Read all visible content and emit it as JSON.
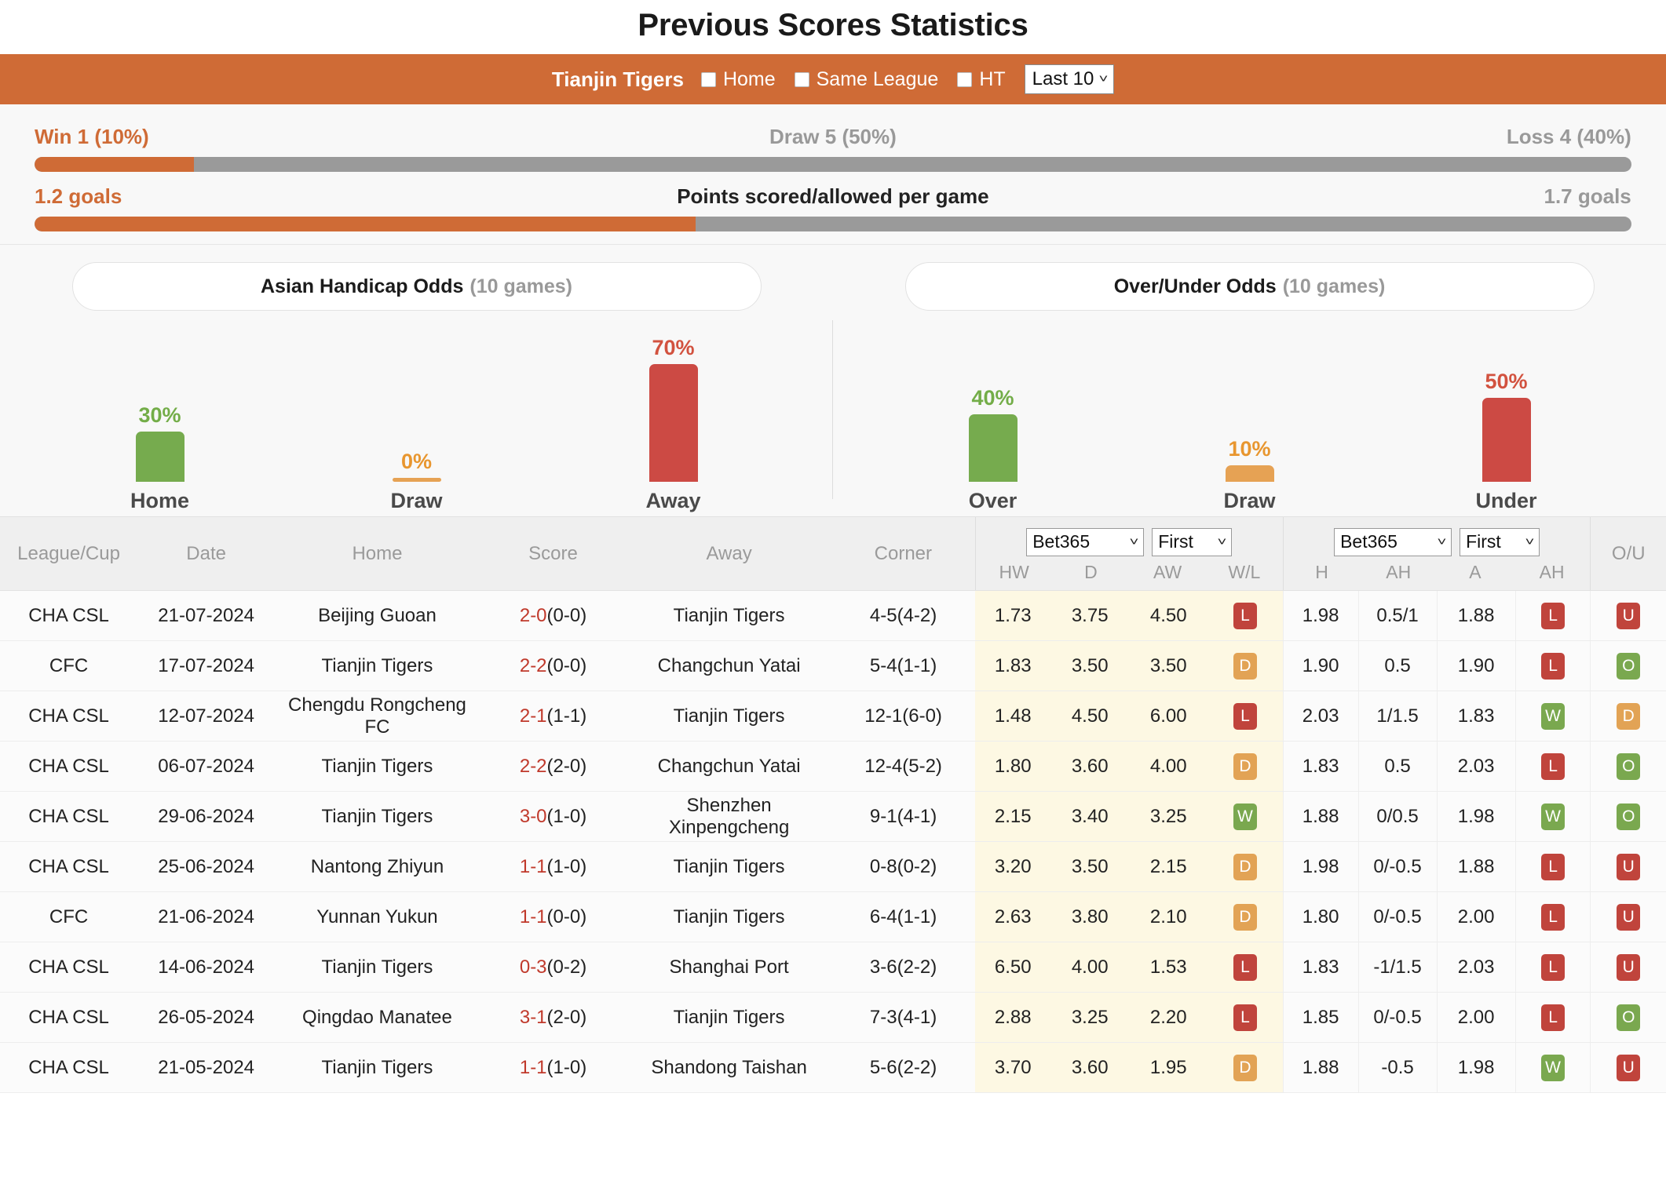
{
  "page_title": "Previous Scores Statistics",
  "filter_bar": {
    "team": "Tianjin Tigers",
    "checkbox_home": "Home",
    "checkbox_same_league": "Same League",
    "checkbox_ht": "HT",
    "range_select": "Last 10",
    "caret_icon": "chevron-down-icon"
  },
  "summary": {
    "win_label": "Win 1 (10%)",
    "draw_label": "Draw 5 (50%)",
    "loss_label": "Loss 4 (40%)",
    "win_pct": 10,
    "goals_scored": "1.2 goals",
    "goals_title": "Points scored/allowed per game",
    "goals_allowed": "1.7 goals",
    "goals_fill_pct": 41.4,
    "accent_color": "#cf6b36",
    "muted_color": "#9a9a9a"
  },
  "odds_panels": [
    {
      "title": "Asian Handicap Odds",
      "games": "(10 games)",
      "bars": [
        {
          "label": "Home",
          "pct": "30%",
          "value": 30,
          "color": "#76ab4e",
          "text_class": "c-green",
          "bg_class": "bg-green"
        },
        {
          "label": "Draw",
          "pct": "0%",
          "value": 0,
          "color": "#e6a254",
          "text_class": "c-orange",
          "bg_class": "bg-orange"
        },
        {
          "label": "Away",
          "pct": "70%",
          "value": 70,
          "color": "#cc4a44",
          "text_class": "c-red",
          "bg_class": "bg-red"
        }
      ]
    },
    {
      "title": "Over/Under Odds",
      "games": "(10 games)",
      "bars": [
        {
          "label": "Over",
          "pct": "40%",
          "value": 40,
          "color": "#76ab4e",
          "text_class": "c-green",
          "bg_class": "bg-green"
        },
        {
          "label": "Draw",
          "pct": "10%",
          "value": 10,
          "color": "#e6a254",
          "text_class": "c-orange",
          "bg_class": "bg-orange"
        },
        {
          "label": "Under",
          "pct": "50%",
          "value": 50,
          "color": "#cc4a44",
          "text_class": "c-red",
          "bg_class": "bg-red"
        }
      ]
    }
  ],
  "table": {
    "headers": {
      "league": "League/Cup",
      "date": "Date",
      "home": "Home",
      "score": "Score",
      "away": "Away",
      "corner": "Corner",
      "ou": "O/U"
    },
    "odds_group": {
      "bookmaker": "Bet365",
      "period": "First",
      "cols": [
        "HW",
        "D",
        "AW",
        "W/L"
      ]
    },
    "ah_group": {
      "bookmaker": "Bet365",
      "period": "First",
      "cols": [
        "H",
        "AH",
        "A",
        "AH"
      ]
    },
    "rows": [
      {
        "league": "CHA CSL",
        "date": "21-07-2024",
        "home": "Beijing Guoan",
        "home_hl": false,
        "score": "2-0",
        "ht": "(0-0)",
        "away": "Tianjin Tigers",
        "away_hl": true,
        "corner": "4-5(4-2)",
        "hw": "1.73",
        "d": "3.75",
        "aw": "4.50",
        "wl": "L",
        "h": "1.98",
        "ah": "0.5/1",
        "a": "1.88",
        "ah_res": "L",
        "ou": "U"
      },
      {
        "league": "CFC",
        "date": "17-07-2024",
        "home": "Tianjin Tigers",
        "home_hl": true,
        "score": "2-2",
        "ht": "(0-0)",
        "away": "Changchun Yatai",
        "away_hl": false,
        "corner": "5-4(1-1)",
        "hw": "1.83",
        "d": "3.50",
        "aw": "3.50",
        "wl": "D",
        "h": "1.90",
        "ah": "0.5",
        "a": "1.90",
        "ah_res": "L",
        "ou": "O"
      },
      {
        "league": "CHA CSL",
        "date": "12-07-2024",
        "home": "Chengdu Rongcheng FC",
        "home_hl": false,
        "score": "2-1",
        "ht": "(1-1)",
        "away": "Tianjin Tigers",
        "away_hl": true,
        "corner": "12-1(6-0)",
        "hw": "1.48",
        "d": "4.50",
        "aw": "6.00",
        "wl": "L",
        "h": "2.03",
        "ah": "1/1.5",
        "a": "1.83",
        "ah_res": "W",
        "ou": "D"
      },
      {
        "league": "CHA CSL",
        "date": "06-07-2024",
        "home": "Tianjin Tigers",
        "home_hl": true,
        "score": "2-2",
        "ht": "(2-0)",
        "away": "Changchun Yatai",
        "away_hl": false,
        "corner": "12-4(5-2)",
        "hw": "1.80",
        "d": "3.60",
        "aw": "4.00",
        "wl": "D",
        "h": "1.83",
        "ah": "0.5",
        "a": "2.03",
        "ah_res": "L",
        "ou": "O"
      },
      {
        "league": "CHA CSL",
        "date": "29-06-2024",
        "home": "Tianjin Tigers",
        "home_hl": true,
        "score": "3-0",
        "ht": "(1-0)",
        "away": "Shenzhen Xinpengcheng",
        "away_hl": false,
        "corner": "9-1(4-1)",
        "hw": "2.15",
        "d": "3.40",
        "aw": "3.25",
        "wl": "W",
        "h": "1.88",
        "ah": "0/0.5",
        "a": "1.98",
        "ah_res": "W",
        "ou": "O"
      },
      {
        "league": "CHA CSL",
        "date": "25-06-2024",
        "home": "Nantong Zhiyun",
        "home_hl": false,
        "score": "1-1",
        "ht": "(1-0)",
        "away": "Tianjin Tigers",
        "away_hl": true,
        "corner": "0-8(0-2)",
        "hw": "3.20",
        "d": "3.50",
        "aw": "2.15",
        "wl": "D",
        "h": "1.98",
        "ah": "0/-0.5",
        "a": "1.88",
        "ah_res": "L",
        "ou": "U"
      },
      {
        "league": "CFC",
        "date": "21-06-2024",
        "home": "Yunnan Yukun",
        "home_hl": false,
        "score": "1-1",
        "ht": "(0-0)",
        "away": "Tianjin Tigers",
        "away_hl": true,
        "corner": "6-4(1-1)",
        "hw": "2.63",
        "d": "3.80",
        "aw": "2.10",
        "wl": "D",
        "h": "1.80",
        "ah": "0/-0.5",
        "a": "2.00",
        "ah_res": "L",
        "ou": "U"
      },
      {
        "league": "CHA CSL",
        "date": "14-06-2024",
        "home": "Tianjin Tigers",
        "home_hl": true,
        "score": "0-3",
        "ht": "(0-2)",
        "away": "Shanghai Port",
        "away_hl": false,
        "corner": "3-6(2-2)",
        "hw": "6.50",
        "d": "4.00",
        "aw": "1.53",
        "wl": "L",
        "h": "1.83",
        "ah": "-1/1.5",
        "a": "2.03",
        "ah_res": "L",
        "ou": "U"
      },
      {
        "league": "CHA CSL",
        "date": "26-05-2024",
        "home": "Qingdao Manatee",
        "home_hl": false,
        "score": "3-1",
        "ht": "(2-0)",
        "away": "Tianjin Tigers",
        "away_hl": true,
        "corner": "7-3(4-1)",
        "hw": "2.88",
        "d": "3.25",
        "aw": "2.20",
        "wl": "L",
        "h": "1.85",
        "ah": "0/-0.5",
        "a": "2.00",
        "ah_res": "L",
        "ou": "O"
      },
      {
        "league": "CHA CSL",
        "date": "21-05-2024",
        "home": "Tianjin Tigers",
        "home_hl": true,
        "score": "1-1",
        "ht": "(1-0)",
        "away": "Shandong Taishan",
        "away_hl": false,
        "corner": "5-6(2-2)",
        "hw": "3.70",
        "d": "3.60",
        "aw": "1.95",
        "wl": "D",
        "h": "1.88",
        "ah": "-0.5",
        "a": "1.98",
        "ah_res": "W",
        "ou": "U"
      }
    ]
  }
}
